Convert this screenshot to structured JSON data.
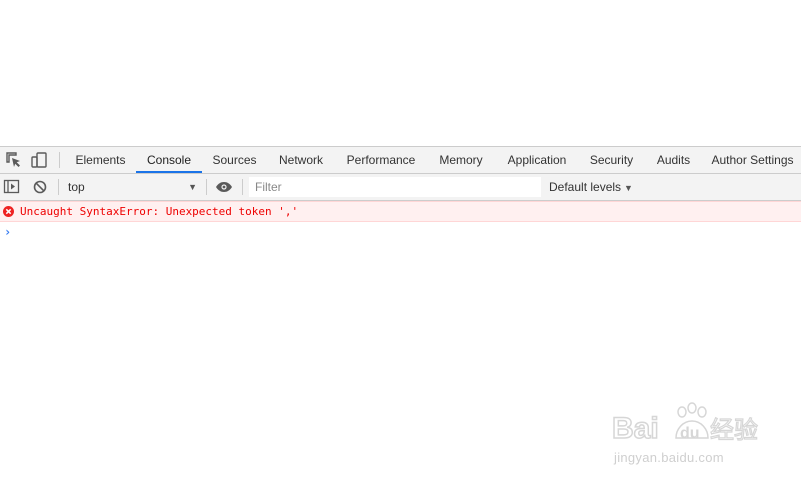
{
  "tabs": [
    {
      "label": "Elements",
      "active": false
    },
    {
      "label": "Console",
      "active": true
    },
    {
      "label": "Sources",
      "active": false
    },
    {
      "label": "Network",
      "active": false
    },
    {
      "label": "Performance",
      "active": false
    },
    {
      "label": "Memory",
      "active": false
    },
    {
      "label": "Application",
      "active": false
    },
    {
      "label": "Security",
      "active": false
    },
    {
      "label": "Audits",
      "active": false
    },
    {
      "label": "Author Settings",
      "active": false
    }
  ],
  "toolbar": {
    "context": "top",
    "filter_placeholder": "Filter",
    "levels": "Default levels"
  },
  "console": {
    "error_message": "Uncaught SyntaxError: Unexpected token ','",
    "prompt": "›"
  },
  "watermark": {
    "brand": "Bai",
    "brand_paw": "du",
    "brand_cn": "经验",
    "url": "jingyan.baidu.com"
  },
  "colors": {
    "accent": "#1a73e8",
    "error": "#ee0000",
    "error_bg": "#fff0f0",
    "prompt": "#367cf1"
  }
}
